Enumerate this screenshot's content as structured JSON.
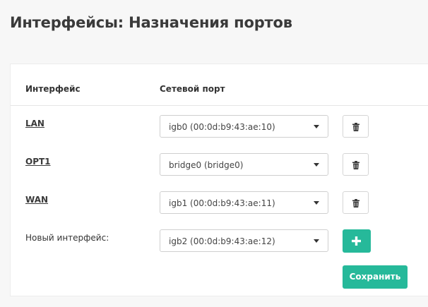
{
  "page": {
    "title": "Интерфейсы: Назначения портов"
  },
  "table": {
    "headers": {
      "interface": "Интерфейс",
      "network_port": "Сетевой порт"
    },
    "rows": [
      {
        "interface": "LAN",
        "port": "igb0 (00:0d:b9:43:ae:10)",
        "action_icon": "trash-icon"
      },
      {
        "interface": "OPT1",
        "port": "bridge0 (bridge0)",
        "action_icon": "trash-icon"
      },
      {
        "interface": "WAN",
        "port": "igb1 (00:0d:b9:43:ae:11)",
        "action_icon": "trash-icon"
      }
    ],
    "new_interface": {
      "label": "Новый интерфейс:",
      "port": "igb2 (00:0d:b9:43:ae:12)",
      "action_icon": "plus-icon"
    }
  },
  "actions": {
    "save_label": "Сохранить"
  },
  "colors": {
    "accent": "#26b99a",
    "background": "#f7f7f7",
    "panel": "#ffffff"
  }
}
